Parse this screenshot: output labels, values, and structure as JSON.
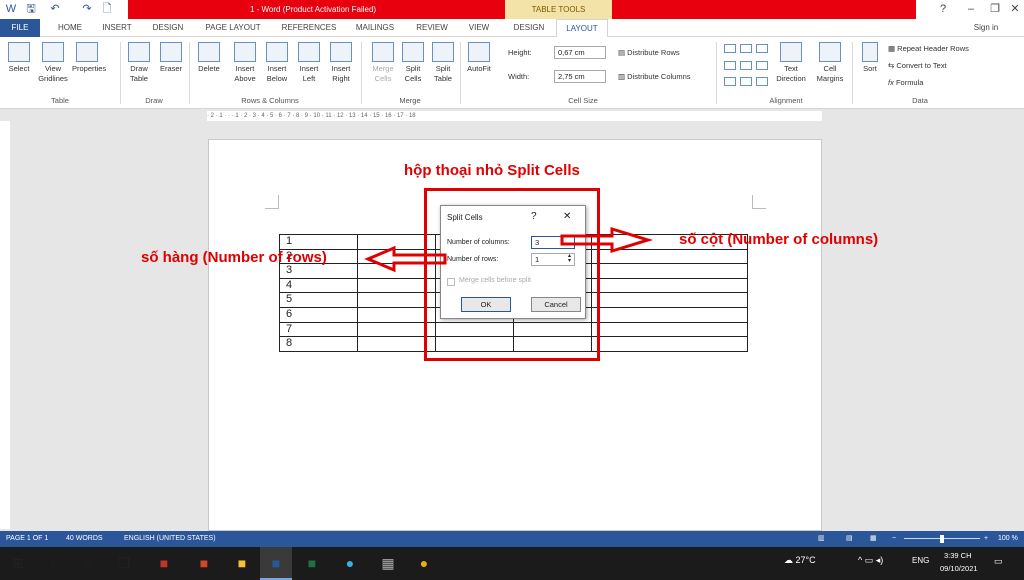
{
  "titlebar": {
    "title": "1 - Word (Product Activation Failed)",
    "table_tools": "TABLE TOOLS",
    "sign_in": "Sign in"
  },
  "tabs": [
    "FILE",
    "HOME",
    "INSERT",
    "DESIGN",
    "PAGE LAYOUT",
    "REFERENCES",
    "MAILINGS",
    "REVIEW",
    "VIEW",
    "DESIGN",
    "LAYOUT"
  ],
  "ribbon": {
    "buttons": [
      [
        "Select",
        ""
      ],
      [
        "View",
        "Gridlines"
      ],
      [
        "Properties",
        ""
      ],
      [
        "Draw",
        "Table"
      ],
      [
        "Eraser",
        ""
      ],
      [
        "Delete",
        ""
      ],
      [
        "Insert",
        "Above"
      ],
      [
        "Insert",
        "Below"
      ],
      [
        "Insert",
        "Left"
      ],
      [
        "Insert",
        "Right"
      ],
      [
        "Merge",
        "Cells"
      ],
      [
        "Split",
        "Cells"
      ],
      [
        "Split",
        "Table"
      ],
      [
        "AutoFit",
        ""
      ]
    ],
    "groups": [
      "Table",
      "Draw",
      "Rows & Columns",
      "Merge",
      "Cell Size",
      "Alignment",
      "Data"
    ],
    "height_label": "Height:",
    "height_value": "0,67 cm",
    "width_label": "Width:",
    "width_value": "2,75 cm",
    "distribute_rows": "Distribute Rows",
    "distribute_columns": "Distribute Columns",
    "text_direction": [
      "Text",
      "Direction"
    ],
    "cell_margins": [
      "Cell",
      "Margins"
    ],
    "sort": "Sort",
    "repeat_header": "Repeat Header Rows",
    "convert_to_text": "Convert to Text",
    "formula": "Formula"
  },
  "ruler_text": "· 2 · 1 · · · 1 · 2 · 3 · 4 · 5 · 6 · 7 · 8 · 9 · 10 · 11 · 12 · 13 · 14 · 15 · 16 · 17 · 18",
  "table_rows": [
    "1",
    "2",
    "3",
    "4",
    "5",
    "6",
    "7",
    "8"
  ],
  "dialog": {
    "title": "Split Cells",
    "help": "?",
    "close": "✕",
    "columns_label": "Number of columns:",
    "columns_value": "3",
    "rows_label": "Number of rows:",
    "rows_value": "1",
    "merge_label": "Merge cells before split",
    "ok": "OK",
    "cancel": "Cancel"
  },
  "annotations": {
    "dialog_note": "hộp thoại nhỏ Split Cells",
    "rows_note": "số hàng (Number of rows)",
    "columns_note": "số cột (Number of columns)"
  },
  "status": {
    "page": "PAGE 1 OF 1",
    "words": "40 WORDS",
    "language": "ENGLISH (UNITED STATES)",
    "zoom": "100 %"
  },
  "taskbar": {
    "weather": "27°C",
    "lang": "ENG",
    "time": "3:39 CH",
    "date": "09/10/2021"
  },
  "colors": {
    "accent": "#2b579a",
    "annotation": "#e00000",
    "title_red": "#e8000f"
  }
}
